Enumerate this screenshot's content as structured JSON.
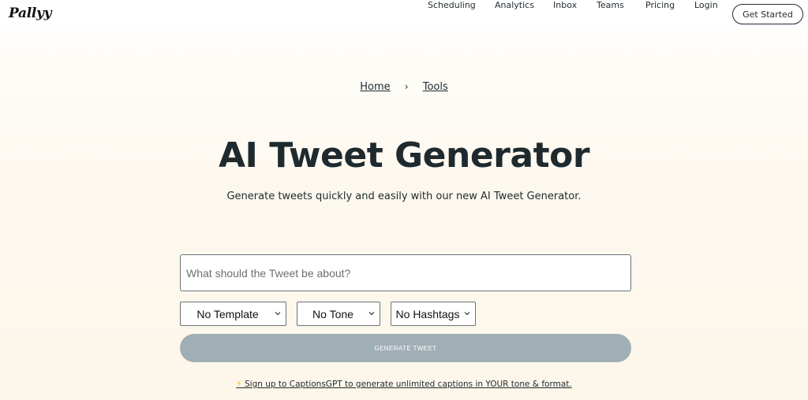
{
  "brand": {
    "logo_text": "Pallyy"
  },
  "nav": {
    "items": [
      {
        "label": "Scheduling"
      },
      {
        "label": "Analytics"
      },
      {
        "label": "Inbox"
      },
      {
        "label": "Teams"
      },
      {
        "label": "Pricing"
      },
      {
        "label": "Login"
      }
    ],
    "cta_label": "Get Started"
  },
  "breadcrumb": {
    "items": [
      {
        "label": "Home"
      },
      {
        "label": "Tools"
      }
    ],
    "separator": "›"
  },
  "hero": {
    "title": "AI Tweet Generator",
    "subtitle": "Generate tweets quickly and easily with our new AI Tweet Generator."
  },
  "form": {
    "topic_placeholder": "What should the Tweet be about?",
    "topic_value": "",
    "template_select": {
      "value": "No Template"
    },
    "tone_select": {
      "value": "No Tone"
    },
    "hashtags_select": {
      "value": "No Hashtags"
    },
    "generate_label": "GENERATE TWEET"
  },
  "promo": {
    "icon": "lightning-bolt-icon",
    "glyph": "⚡",
    "text": "Sign up to CaptionsGPT to generate unlimited captions in YOUR tone & format."
  },
  "colors": {
    "text": "#1f2a2e",
    "button_disabled": "#a0aeb5",
    "background_warm": "#fdf6ea"
  }
}
